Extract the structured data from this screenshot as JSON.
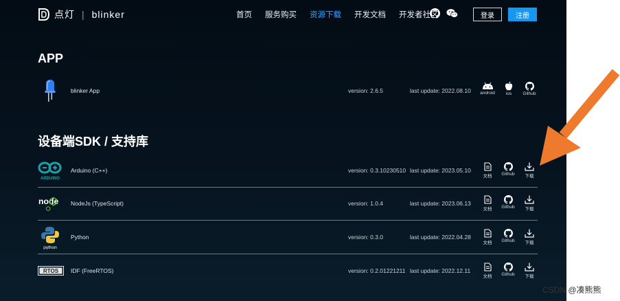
{
  "header": {
    "logo_text": "点灯",
    "logo_sep": "|",
    "logo_brand": "blinker",
    "nav": [
      "首页",
      "服务购买",
      "资源下载",
      "开发文档",
      "开发者社区"
    ],
    "login": "登录",
    "register": "注册"
  },
  "app_section": {
    "title": "APP",
    "rows": [
      {
        "name": "blinker App",
        "version": "version: 2.6.5",
        "update": "last update: 2022.08.10",
        "actions": [
          "android",
          "ios",
          "Github"
        ]
      }
    ]
  },
  "sdk_section": {
    "title": "设备端SDK / 支持库",
    "rows": [
      {
        "name": "Arduino (C++)",
        "version": "version: 0.3.10230510",
        "update": "last update: 2023.05.10",
        "logo_text": "ARDUINO",
        "actions": [
          "文档",
          "Github",
          "下载"
        ]
      },
      {
        "name": "NodeJs (TypeScript)",
        "version": "version: 1.0.4",
        "update": "last update: 2023.06.13",
        "logo_text": "node",
        "actions": [
          "文档",
          "Github",
          "下载"
        ]
      },
      {
        "name": "Python",
        "version": "version: 0.3.0",
        "update": "last update: 2022.04.28",
        "logo_text": "python",
        "actions": [
          "文档",
          "Github",
          "下载"
        ]
      },
      {
        "name": "IDF (FreeRTOS)",
        "version": "version: 0.2.01221211",
        "update": "last update: 2022.12.11",
        "logo_text": "RTOS",
        "actions": [
          "文档",
          "Github",
          "下载"
        ]
      }
    ]
  },
  "watermark": "CSDN @凑熊熊",
  "colors": {
    "accent": "#1697f0",
    "arrow": "#ee7a2e",
    "background": "#06131f"
  }
}
